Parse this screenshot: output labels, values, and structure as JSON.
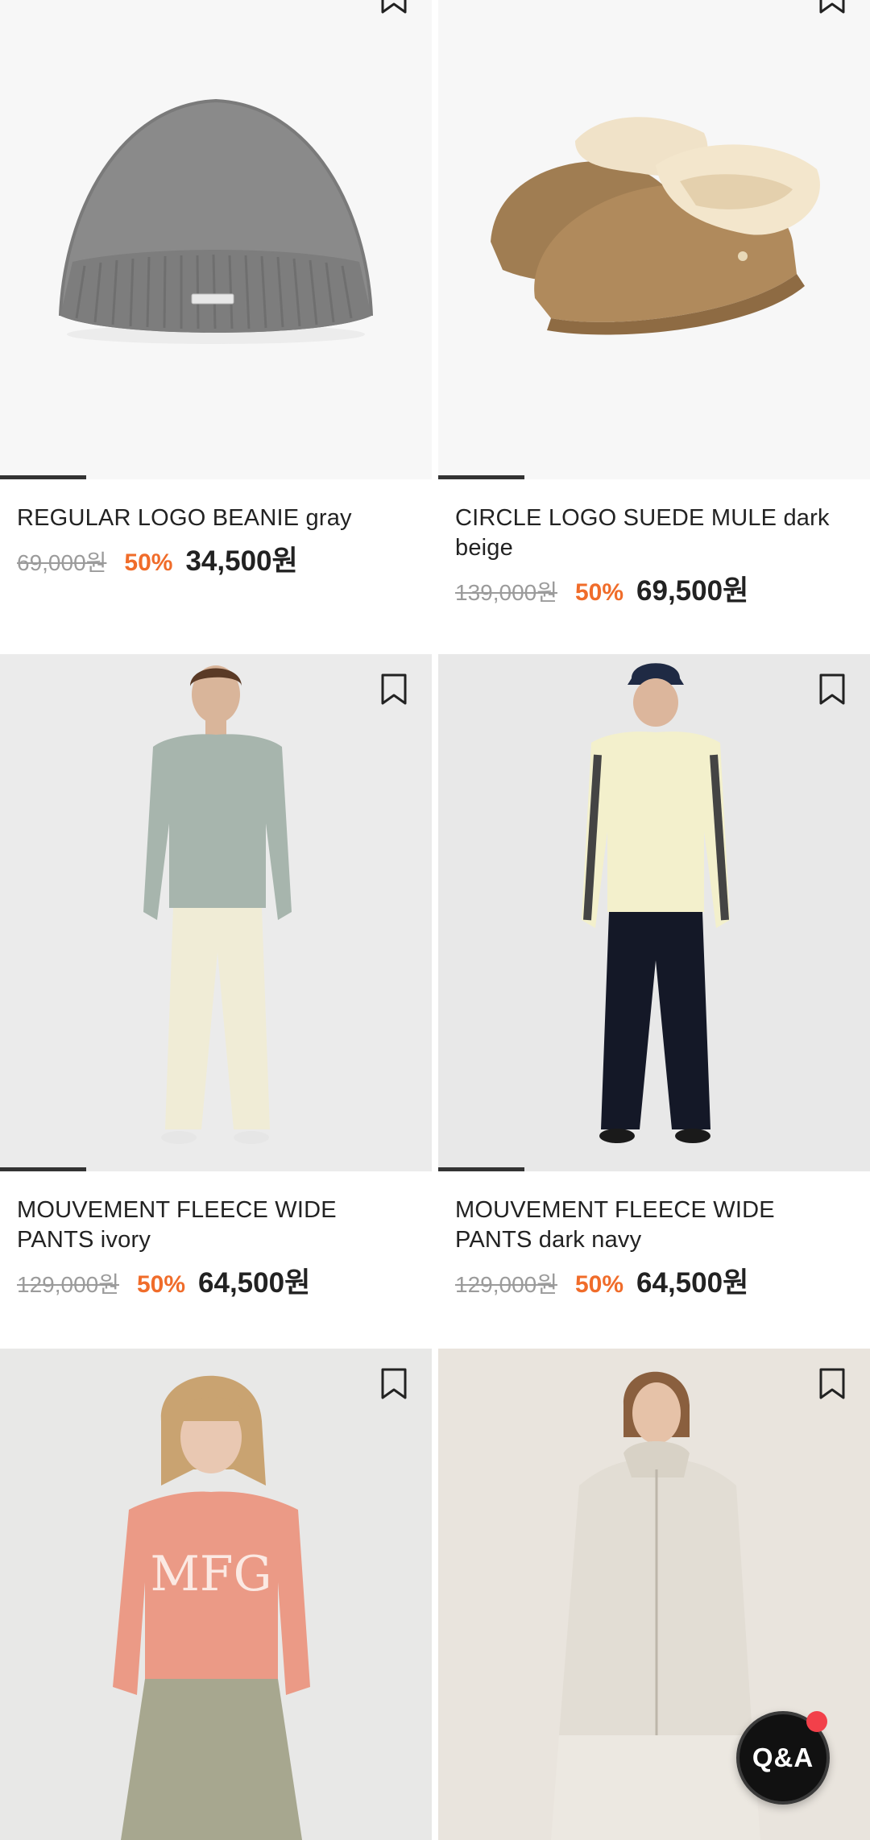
{
  "products": [
    {
      "name": "REGULAR LOGO BEANIE gray",
      "original_price": "69,000원",
      "discount": "50%",
      "sale_price": "34,500원",
      "image_progress": 0.2
    },
    {
      "name": "CIRCLE LOGO SUEDE MULE dark beige",
      "original_price": "139,000원",
      "discount": "50%",
      "sale_price": "69,500원",
      "image_progress": 0.2
    },
    {
      "name": "MOUVEMENT FLEECE WIDE PANTS ivory",
      "original_price": "129,000원",
      "discount": "50%",
      "sale_price": "64,500원",
      "image_progress": 0.2
    },
    {
      "name": "MOUVEMENT FLEECE WIDE PANTS dark navy",
      "original_price": "129,000원",
      "discount": "50%",
      "sale_price": "64,500원",
      "image_progress": 0.2
    }
  ],
  "floating": {
    "qa_label": "Q&A"
  },
  "icons": {
    "bookmark": "bookmark-icon",
    "qa": "qa-button"
  },
  "colors": {
    "discount": "#f06c2a",
    "notification_dot": "#f2404a",
    "price_text": "#222222",
    "original_price": "#9b9b9b"
  }
}
